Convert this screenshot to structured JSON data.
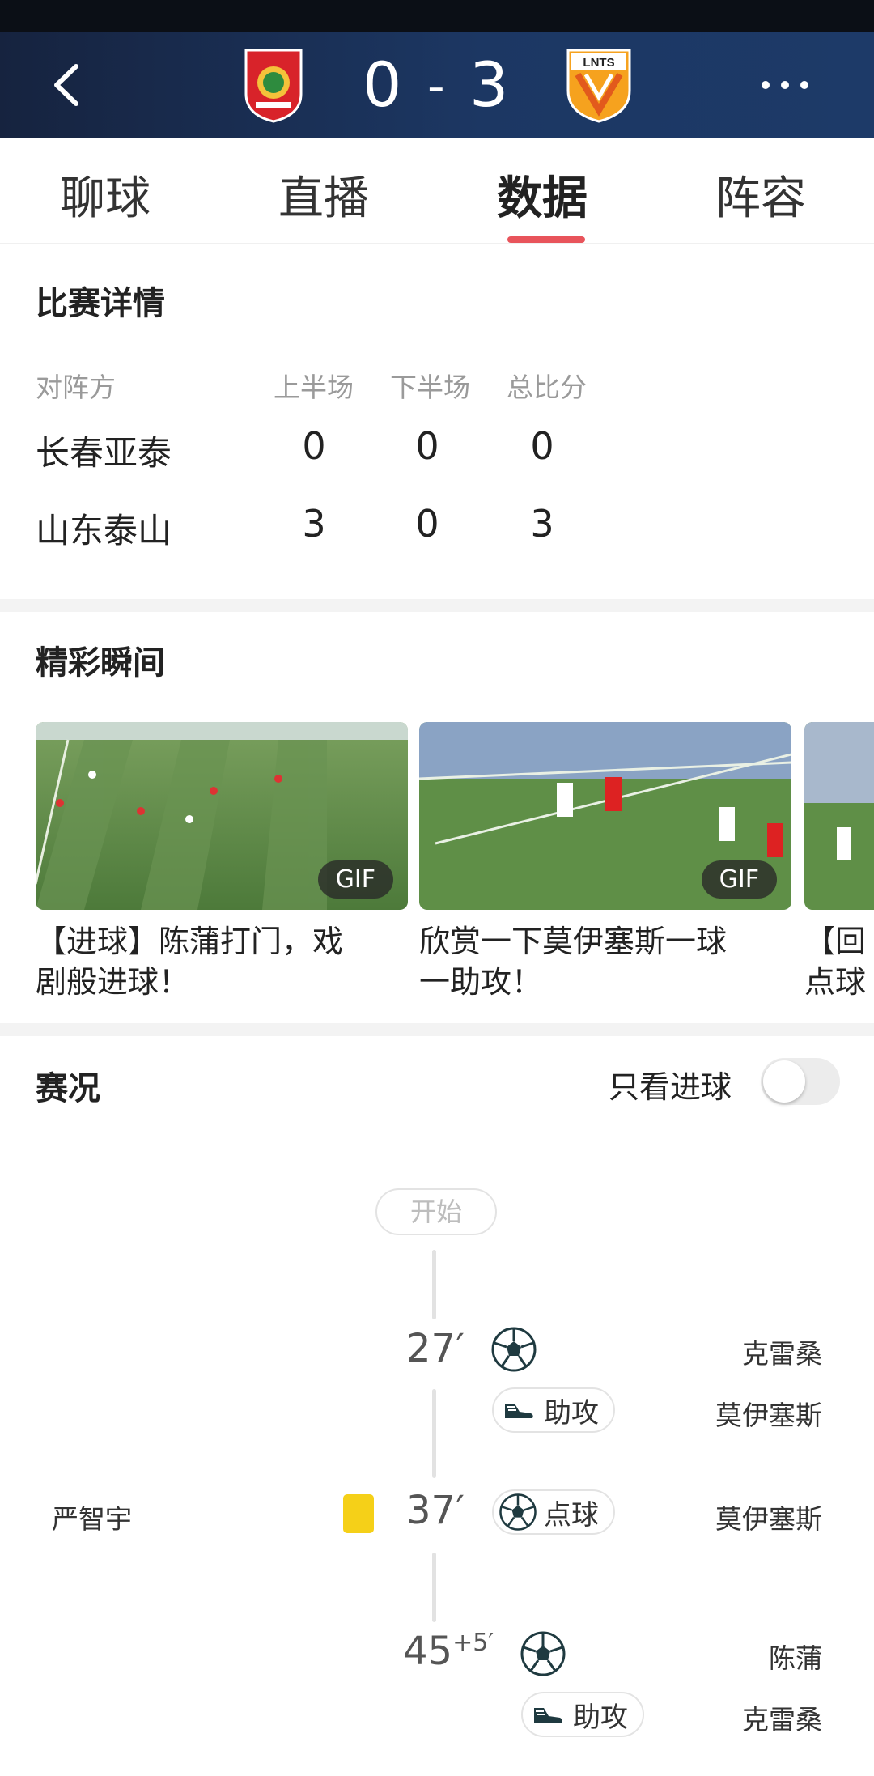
{
  "match": {
    "home_score": "0",
    "dash": "-",
    "away_score": "3",
    "away_logo_text": "LNTS"
  },
  "tabs": [
    "聊球",
    "直播",
    "数据",
    "阵容"
  ],
  "active_tab": "数据",
  "details": {
    "title": "比赛详情",
    "headers": [
      "对阵方",
      "上半场",
      "下半场",
      "总比分"
    ],
    "rows": [
      {
        "team": "长春亚泰",
        "first_half": "0",
        "second_half": "0",
        "total": "0"
      },
      {
        "team": "山东泰山",
        "first_half": "3",
        "second_half": "0",
        "total": "3"
      }
    ]
  },
  "highlights": {
    "title": "精彩瞬间",
    "items": [
      {
        "caption_line1": "【进球】陈蒲打门，戏",
        "caption_line2": "剧般进球！",
        "badge": "GIF"
      },
      {
        "caption_line1": "欣赏一下莫伊塞斯一球",
        "caption_line2": "一助攻！",
        "badge": "GIF"
      },
      {
        "caption_line1": "【回",
        "caption_line2": "点球"
      }
    ]
  },
  "events": {
    "title": "赛况",
    "goals_only_label": "只看进球",
    "goals_only_on": false,
    "start_label": "开始",
    "list": [
      {
        "minute": "27′",
        "type": "goal",
        "player": "克雷桑",
        "assist_label": "助攻",
        "assist_player": "莫伊塞斯"
      },
      {
        "minute": "37′",
        "type": "penalty",
        "penalty_label": "点球",
        "player": "莫伊塞斯",
        "home_player": "严智宇",
        "home_event": "yellow-card"
      },
      {
        "minute": "45",
        "added": "+5′",
        "type": "goal",
        "player": "陈蒲",
        "assist_label": "助攻",
        "assist_player": "克雷桑"
      }
    ]
  },
  "colors": {
    "header": "#1c3763",
    "accent": "#e8545b",
    "yellow_card": "#f5d018"
  },
  "icons": [
    "back-arrow-icon",
    "more-dots-icon",
    "soccer-ball-icon",
    "boot-icon",
    "yellow-card-icon"
  ]
}
